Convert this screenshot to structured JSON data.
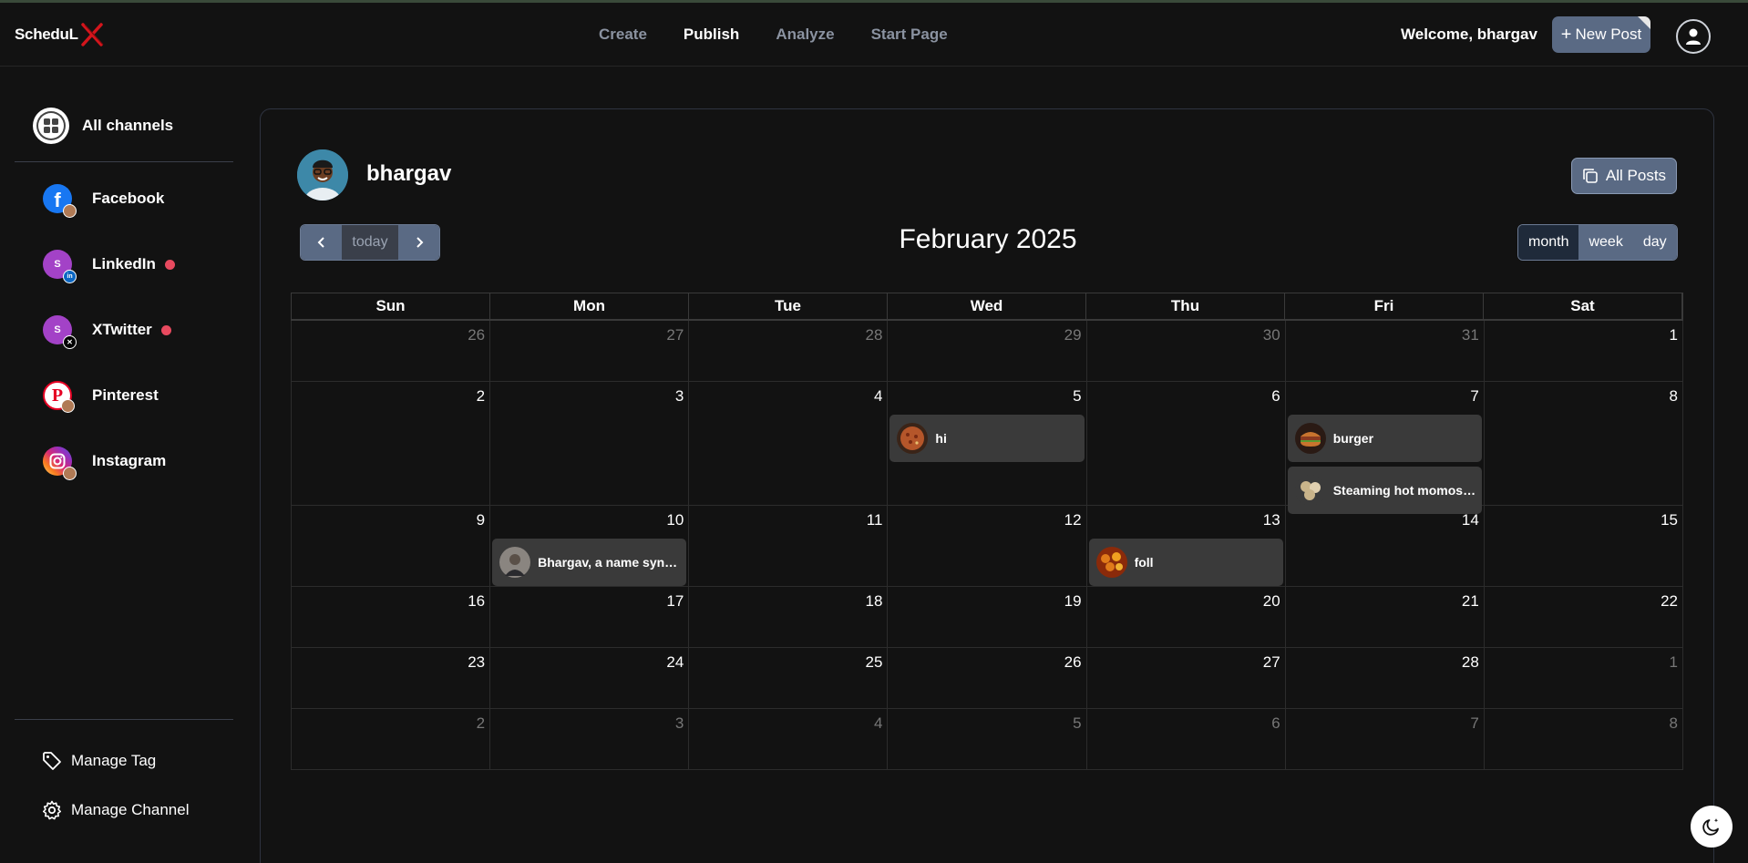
{
  "app": {
    "logo_text": "ScheduL"
  },
  "nav": {
    "items": [
      "Create",
      "Publish",
      "Analyze",
      "Start Page"
    ],
    "active": "Publish"
  },
  "header": {
    "welcome": "Welcome, bhargav",
    "new_post": "New Post"
  },
  "sidebar": {
    "all_channels": "All channels",
    "channels": [
      {
        "label": "Facebook",
        "icon": "facebook-icon",
        "color": "#1877f2",
        "alert": false
      },
      {
        "label": "LinkedIn",
        "icon": "linkedin-icon",
        "color": "#a342c7",
        "alert": true,
        "initial": "S"
      },
      {
        "label": "XTwitter",
        "icon": "x-twitter-icon",
        "color": "#a342c7",
        "alert": true,
        "initial": "S"
      },
      {
        "label": "Pinterest",
        "icon": "pinterest-icon",
        "color": "#e60023",
        "alert": false
      },
      {
        "label": "Instagram",
        "icon": "instagram-icon",
        "color": "#d6249f",
        "alert": false
      }
    ],
    "manage_tag": "Manage Tag",
    "manage_channel": "Manage Channel"
  },
  "panel": {
    "user_name": "bhargav",
    "all_posts": "All Posts",
    "today": "today",
    "title": "February 2025",
    "views": [
      "month",
      "week",
      "day"
    ],
    "active_view": "month"
  },
  "calendar": {
    "weekdays": [
      "Sun",
      "Mon",
      "Tue",
      "Wed",
      "Thu",
      "Fri",
      "Sat"
    ],
    "weeks": [
      {
        "days": [
          [
            "26",
            true
          ],
          [
            "27",
            true
          ],
          [
            "28",
            true
          ],
          [
            "29",
            true
          ],
          [
            "30",
            true
          ],
          [
            "31",
            true
          ],
          [
            "1",
            false
          ]
        ]
      },
      {
        "days": [
          [
            "2",
            false
          ],
          [
            "3",
            false
          ],
          [
            "4",
            false
          ],
          [
            "5",
            false
          ],
          [
            "6",
            false
          ],
          [
            "7",
            false
          ],
          [
            "8",
            false
          ]
        ]
      },
      {
        "days": [
          [
            "9",
            false
          ],
          [
            "10",
            false
          ],
          [
            "11",
            false
          ],
          [
            "12",
            false
          ],
          [
            "13",
            false
          ],
          [
            "14",
            false
          ],
          [
            "15",
            false
          ]
        ]
      },
      {
        "days": [
          [
            "16",
            false
          ],
          [
            "17",
            false
          ],
          [
            "18",
            false
          ],
          [
            "19",
            false
          ],
          [
            "20",
            false
          ],
          [
            "21",
            false
          ],
          [
            "22",
            false
          ]
        ]
      },
      {
        "days": [
          [
            "23",
            false
          ],
          [
            "24",
            false
          ],
          [
            "25",
            false
          ],
          [
            "26",
            false
          ],
          [
            "27",
            false
          ],
          [
            "28",
            false
          ],
          [
            "1",
            true
          ]
        ]
      },
      {
        "days": [
          [
            "2",
            true
          ],
          [
            "3",
            true
          ],
          [
            "4",
            true
          ],
          [
            "5",
            true
          ],
          [
            "6",
            true
          ],
          [
            "7",
            true
          ],
          [
            "8",
            true
          ]
        ]
      }
    ],
    "events": [
      {
        "week": 1,
        "day": 3,
        "slot": 0,
        "text": "hi",
        "thumb": "pizza",
        "thumb_color": "#b5562a"
      },
      {
        "week": 1,
        "day": 5,
        "slot": 0,
        "text": "burger",
        "thumb": "burger",
        "thumb_color": "#8a3a20"
      },
      {
        "week": 1,
        "day": 5,
        "slot": 1,
        "text": "Steaming hot momos, ...",
        "thumb": "momos",
        "thumb_color": "#c9b48a"
      },
      {
        "week": 2,
        "day": 1,
        "slot": 0,
        "text": "Bhargav, a name syno...",
        "thumb": "person",
        "thumb_color": "#5a5048"
      },
      {
        "week": 2,
        "day": 4,
        "slot": 0,
        "text": "foll",
        "thumb": "flowers",
        "thumb_color": "#e07a1a"
      }
    ]
  }
}
